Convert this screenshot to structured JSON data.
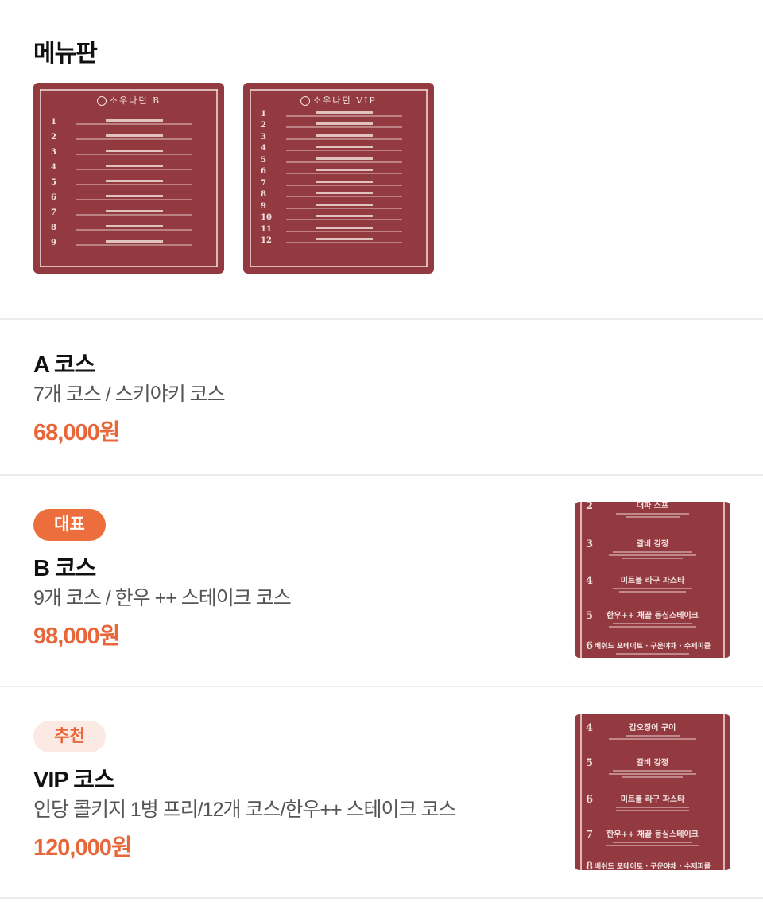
{
  "menu_board": {
    "title": "메뉴판",
    "cards": [
      {
        "header": "소우나던 B",
        "items": [
          "1",
          "2",
          "3",
          "4",
          "5",
          "6",
          "7",
          "8",
          "9"
        ]
      },
      {
        "header": "소우나던 VIP",
        "items": [
          "1",
          "2",
          "3",
          "4",
          "5",
          "6",
          "7",
          "8",
          "9",
          "10",
          "11",
          "12"
        ]
      }
    ]
  },
  "courses": [
    {
      "badge": "",
      "name": "A 코스",
      "description": "7개 코스 / 스키야키 코스",
      "price": "68,000원"
    },
    {
      "badge": "대표",
      "name": "B 코스",
      "description": "9개 코스 / 한우 ++ 스테이크 코스",
      "price": "98,000원",
      "thumbnail": [
        {
          "num": "2",
          "title": "대파 스프"
        },
        {
          "num": "3",
          "title": "갈비 강정"
        },
        {
          "num": "4",
          "title": "미트볼 라구 파스타"
        },
        {
          "num": "5",
          "title": "한우++ 채끝 등심스테이크"
        },
        {
          "num": "6",
          "title": "배쉬드 포테이토 · 구운야채 · 수제피클"
        }
      ]
    },
    {
      "badge": "추천",
      "name": "VIP 코스",
      "description": "인당 콜키지 1병 프리/12개 코스/한우++ 스테이크 코스",
      "price": "120,000원",
      "thumbnail": [
        {
          "num": "4",
          "title": "갑오징어 구이"
        },
        {
          "num": "5",
          "title": "갈비 강정"
        },
        {
          "num": "6",
          "title": "미트볼 라구 파스타"
        },
        {
          "num": "7",
          "title": "한우++ 채끝 등심스테이크"
        },
        {
          "num": "8",
          "title": "배쉬드 포테이토 · 구운야채 · 수제피클"
        }
      ]
    }
  ],
  "colors": {
    "accent": "#e8673a",
    "badge_primary_bg": "#ec6e3d",
    "badge_soft_bg": "#fbeae4",
    "menu_card_bg": "#933a40"
  }
}
